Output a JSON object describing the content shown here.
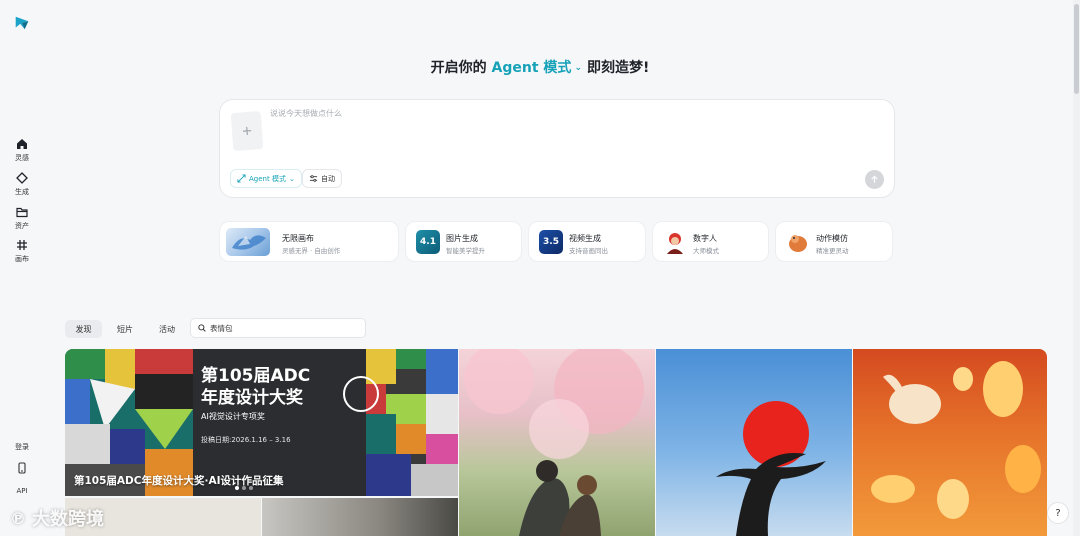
{
  "sidebar": {
    "items": [
      {
        "label": "灵感",
        "icon": "home-icon"
      },
      {
        "label": "生成",
        "icon": "diamond-icon"
      },
      {
        "label": "资产",
        "icon": "folder-icon"
      },
      {
        "label": "画布",
        "icon": "canvas-icon"
      }
    ],
    "login": "登录",
    "api": "API"
  },
  "header": {
    "prefix": "开启你的",
    "mode": "Agent 模式",
    "suffix": "即刻造梦!"
  },
  "composer": {
    "placeholder": "说说今天想做点什么",
    "agent_chip": "Agent 模式",
    "auto_chip": "自动"
  },
  "features": [
    {
      "title": "无限画布",
      "sub": "灵感无界 · 自由创作"
    },
    {
      "title": "图片生成",
      "sub": "智能美学提升",
      "badge": "4.1"
    },
    {
      "title": "视频生成",
      "sub": "支持音画同出",
      "badge": "3.5"
    },
    {
      "title": "数字人",
      "sub": "大师模式"
    },
    {
      "title": "动作模仿",
      "sub": "精准更灵动"
    }
  ],
  "tabs": [
    "发现",
    "短片",
    "活动"
  ],
  "search": {
    "placeholder": "表情包"
  },
  "banner": {
    "title_line1": "第105届ADC",
    "title_line2": "年度设计大奖",
    "subtitle": "AI视觉设计专项奖",
    "date": "投稿日期:2026.1.16 – 3.16",
    "caption": "第105届ADC年度设计大奖·AI设计作品征集"
  },
  "watermark": "大数跨境",
  "colors": {
    "accent": "#17a2b8",
    "background": "#f6f7f9"
  }
}
